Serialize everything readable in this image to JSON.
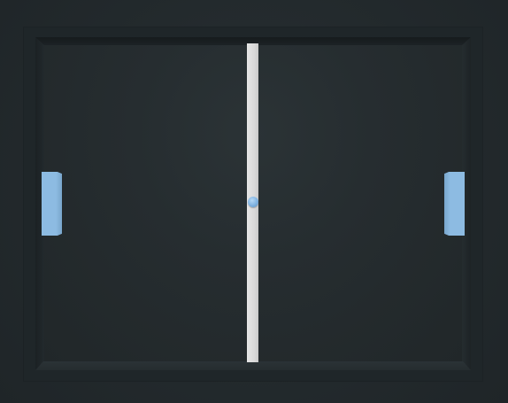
{
  "game": {
    "type": "pong",
    "left_paddle": {
      "color": "#8dbbe2"
    },
    "right_paddle": {
      "color": "#8dbbe2"
    },
    "ball": {
      "color": "#7fb2e0"
    },
    "net": {
      "color": "#e0e0e0"
    },
    "field": {
      "background_color": "#242b2e"
    },
    "frame": {
      "color": "#1f2629"
    }
  }
}
